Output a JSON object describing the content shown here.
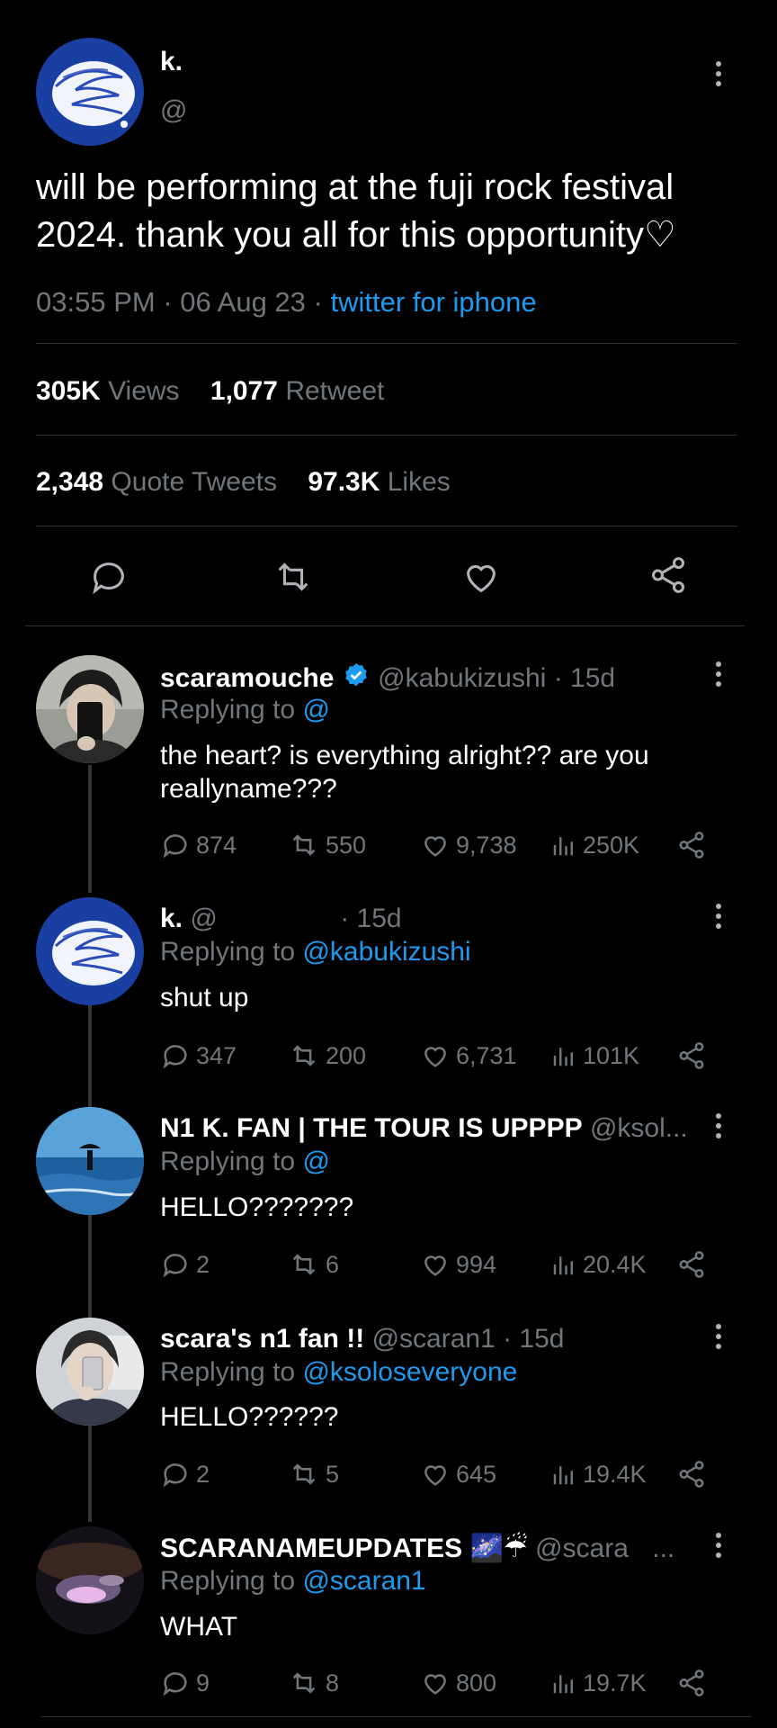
{
  "main": {
    "name": "k.",
    "handle": "@",
    "text": "will be performing at the fuji rock festival 2024. thank you all for this opportunity♡",
    "time": "03:55 PM",
    "date": "06 Aug 23",
    "source": "twitter for iphone",
    "views_count": "305K",
    "views_label": "Views",
    "retweets_count": "1,077",
    "retweets_label": "Retweet",
    "quotes_count": "2,348",
    "quotes_label": "Quote Tweets",
    "likes_count": "97.3K",
    "likes_label": "Likes"
  },
  "replies": [
    {
      "name": "scaramouche",
      "handle": "@kabukizushi",
      "time": "· 15d",
      "replying_prefix": "Replying to",
      "replying_to": "@",
      "text": "the heart? is everything alright?? are you reallyname???",
      "comments": "874",
      "retweets": "550",
      "likes": "9,738",
      "views": "250K"
    },
    {
      "name": "k.",
      "handle": "@",
      "time": "· 15d",
      "replying_prefix": "Replying to",
      "replying_to": "@kabukizushi",
      "text": "shut up",
      "comments": "347",
      "retweets": "200",
      "likes": "6,731",
      "views": "101K"
    },
    {
      "name": "N1 K. FAN | THE TOUR IS UPPPP",
      "handle": "@ksol...",
      "time": "",
      "replying_prefix": "Replying to",
      "replying_to": "@",
      "text": "HELLO???????",
      "comments": "2",
      "retweets": "6",
      "likes": "994",
      "views": "20.4K"
    },
    {
      "name": "scara's n1 fan !!",
      "handle": "@scaran1",
      "time": "· 15d",
      "replying_prefix": "Replying to",
      "replying_to": "@ksoloseveryone",
      "text": "HELLO??????",
      "comments": "2",
      "retweets": "5",
      "likes": "645",
      "views": "19.4K"
    },
    {
      "name": "SCARANAMEUPDATES 🌌☔",
      "handle": "@scara",
      "time": "...",
      "replying_prefix": "Replying to",
      "replying_to": "@scaran1",
      "text": "WHAT",
      "comments": "9",
      "retweets": "8",
      "likes": "800",
      "views": "19.7K"
    }
  ],
  "colors": {
    "accent": "#1d9bf0",
    "background": "#000000",
    "muted": "#71767b",
    "divider": "#2f3336"
  },
  "icons": [
    "more-icon",
    "reply-icon",
    "retweet-icon",
    "like-icon",
    "share-icon",
    "views-icon",
    "verified-icon"
  ]
}
